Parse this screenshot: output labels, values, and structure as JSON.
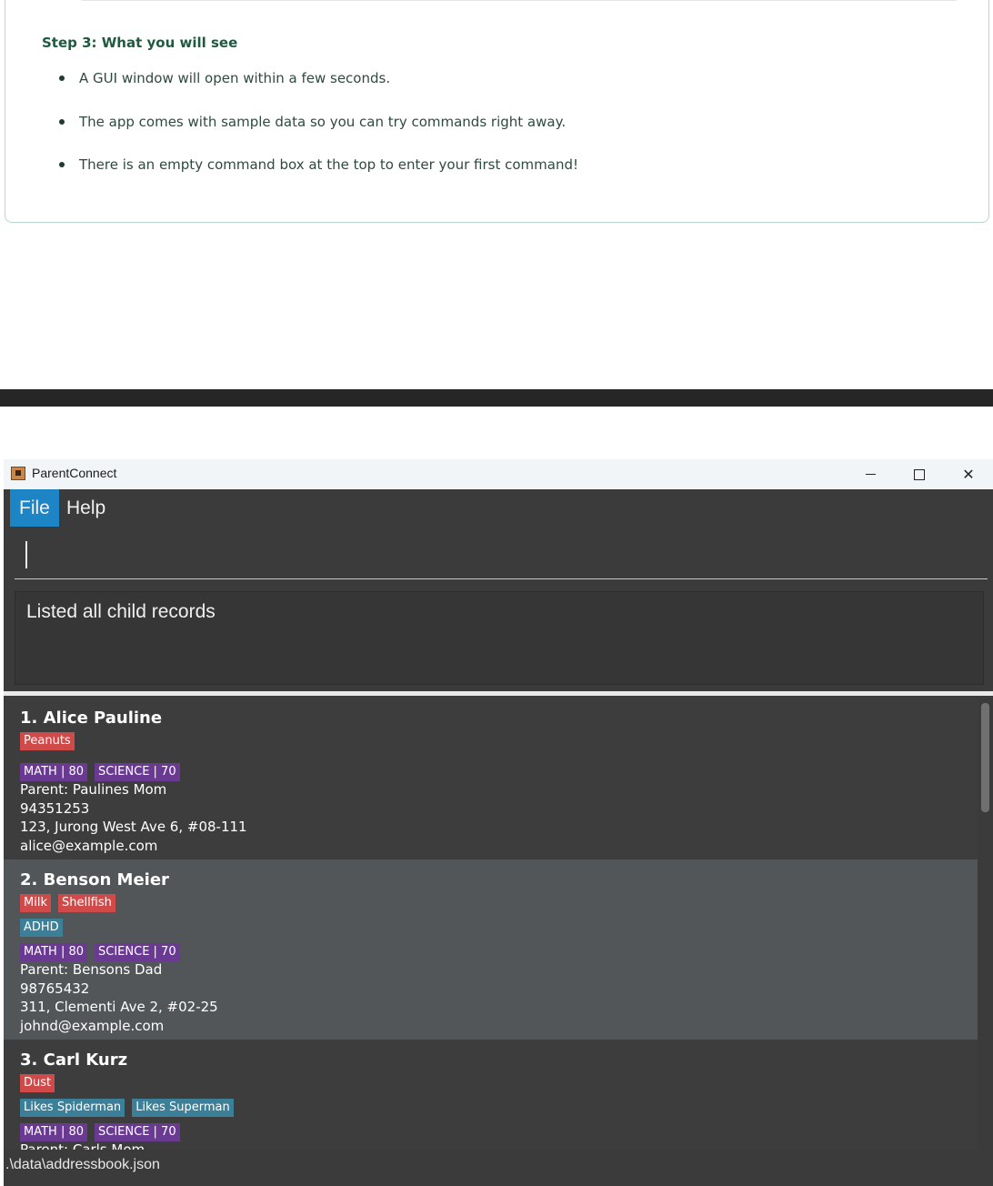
{
  "doc": {
    "step_title": "Step 3: What you will see",
    "bullets": [
      "A GUI window will open within a few seconds.",
      "The app comes with sample data so you can try commands right away.",
      "There is an empty command box at the top to enter your first command!"
    ]
  },
  "window": {
    "title": "ParentConnect",
    "icons": {
      "app": "addressbook-icon",
      "minimize": "minimize-icon",
      "maximize": "maximize-icon",
      "close": "close-icon"
    }
  },
  "menu": {
    "file": "File",
    "help": "Help"
  },
  "command": {
    "value": ""
  },
  "result": {
    "text": "Listed all child records"
  },
  "contacts": [
    {
      "name": "1. Alice Pauline",
      "allergies": [
        "Peanuts"
      ],
      "notes": [],
      "grades": [
        "MATH | 80",
        "SCIENCE | 70"
      ],
      "parent": "Parent: Paulines Mom",
      "phone": "94351253",
      "address": "123, Jurong West Ave 6, #08-111",
      "email": "alice@example.com"
    },
    {
      "name": "2. Benson Meier",
      "allergies": [
        "Milk",
        "Shellfish"
      ],
      "notes": [
        "ADHD"
      ],
      "grades": [
        "MATH | 80",
        "SCIENCE | 70"
      ],
      "parent": "Parent: Bensons Dad",
      "phone": "98765432",
      "address": "311, Clementi Ave 2, #02-25",
      "email": "johnd@example.com"
    },
    {
      "name": "3. Carl Kurz",
      "allergies": [
        "Dust"
      ],
      "notes": [
        "Likes Spiderman",
        "Likes Superman"
      ],
      "grades": [
        "MATH | 80",
        "SCIENCE | 70"
      ],
      "parent": "Parent: Carls Mom",
      "phone": "",
      "address": "",
      "email": ""
    }
  ],
  "colors": {
    "allergy_tag": "#d04a4a",
    "note_tag": "#3b7f98",
    "grade_tag": "#6a3a92",
    "menu_active": "#1d84c6"
  },
  "status": {
    "path": ".\\data\\addressbook.json"
  }
}
